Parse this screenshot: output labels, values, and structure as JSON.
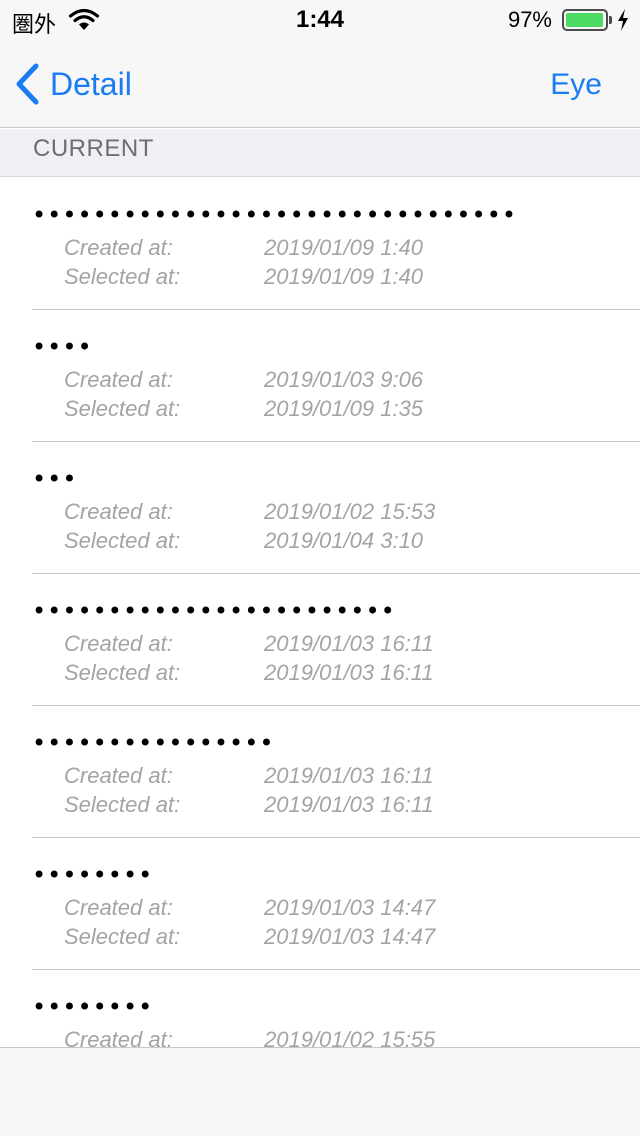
{
  "status_bar": {
    "carrier": "圏外",
    "time": "1:44",
    "battery_percent": "97%",
    "battery_level": 0.97
  },
  "nav": {
    "back_label": "Detail",
    "right_button": "Eye"
  },
  "section": {
    "title": "CURRENT"
  },
  "labels": {
    "created": "Created at:",
    "selected": "Selected at:"
  },
  "items": [
    {
      "masked": "••••••••••••••••••••••••••••••••",
      "created": "2019/01/09 1:40",
      "selected": "2019/01/09 1:40"
    },
    {
      "masked": "••••",
      "created": "2019/01/03 9:06",
      "selected": "2019/01/09 1:35"
    },
    {
      "masked": "•••",
      "created": "2019/01/02 15:53",
      "selected": "2019/01/04 3:10"
    },
    {
      "masked": "••••••••••••••••••••••••",
      "created": "2019/01/03 16:11",
      "selected": "2019/01/03 16:11"
    },
    {
      "masked": "••••••••••••••••",
      "created": "2019/01/03 16:11",
      "selected": "2019/01/03 16:11"
    },
    {
      "masked": "••••••••",
      "created": "2019/01/03 14:47",
      "selected": "2019/01/03 14:47"
    },
    {
      "masked": "••••••••",
      "created": "2019/01/02 15:55",
      "selected": ""
    }
  ],
  "colors": {
    "accent": "#1a7cf2",
    "battery": "#4cd964",
    "secondary_text": "#a3a3a8"
  }
}
